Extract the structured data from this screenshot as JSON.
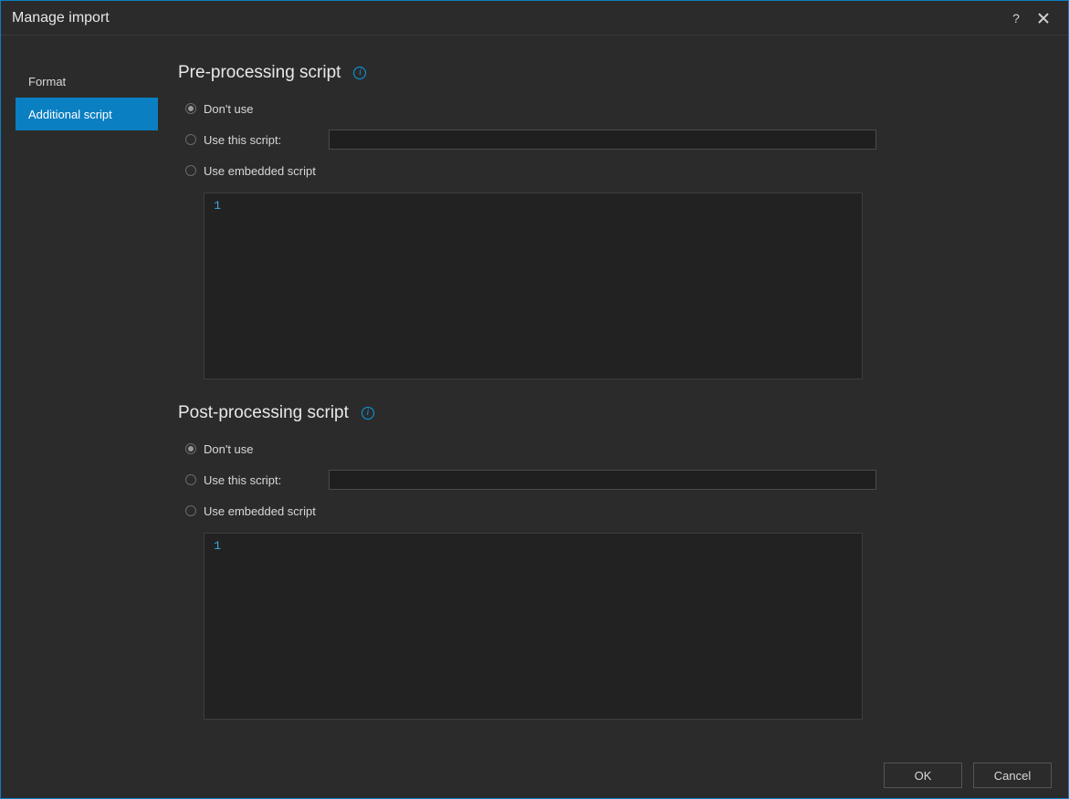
{
  "window": {
    "title": "Manage import"
  },
  "sidebar": {
    "items": [
      {
        "label": "Format",
        "selected": false
      },
      {
        "label": "Additional script",
        "selected": true
      }
    ]
  },
  "sections": {
    "pre": {
      "heading": "Pre-processing script",
      "radios": {
        "dont_use": "Don't use",
        "use_this": "Use this script:",
        "use_embedded": "Use embedded script"
      },
      "selected": "dont_use",
      "script_path": "",
      "editor": {
        "line_numbers": [
          "1"
        ],
        "content": ""
      }
    },
    "post": {
      "heading": "Post-processing script",
      "radios": {
        "dont_use": "Don't use",
        "use_this": "Use this script:",
        "use_embedded": "Use embedded script"
      },
      "selected": "dont_use",
      "script_path": "",
      "editor": {
        "line_numbers": [
          "1"
        ],
        "content": ""
      }
    }
  },
  "footer": {
    "ok": "OK",
    "cancel": "Cancel"
  },
  "icons": {
    "info_glyph": "i",
    "help_glyph": "?"
  }
}
